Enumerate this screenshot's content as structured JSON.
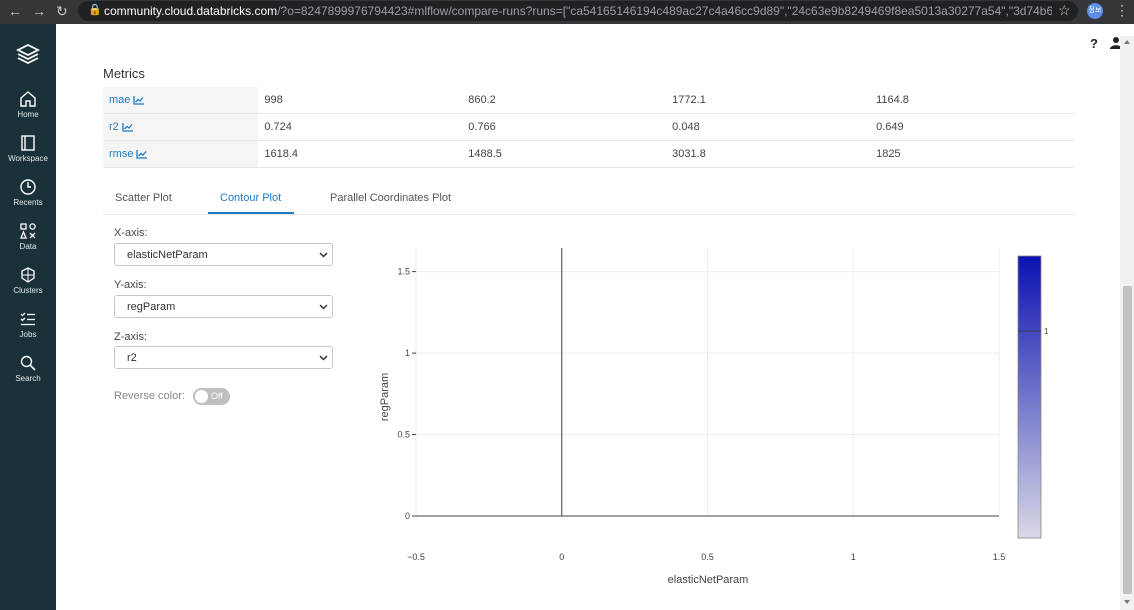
{
  "browser": {
    "url_host": "community.cloud.databricks.com",
    "url_rest": "/?o=8247899976794423#mlflow/compare-runs?runs=[\"ca54165146194c489ac27c4a46cc9d89\",\"24c63e9b8249469f8ea5013a30277a54\",\"3d74b625a8e246c390d58907c0086...",
    "profile_label": "정보"
  },
  "sidebar": {
    "items": [
      {
        "label": "Home",
        "icon": "home-icon"
      },
      {
        "label": "Workspace",
        "icon": "workspace-icon"
      },
      {
        "label": "Recents",
        "icon": "clock-icon"
      },
      {
        "label": "Data",
        "icon": "data-icon"
      },
      {
        "label": "Clusters",
        "icon": "clusters-icon"
      },
      {
        "label": "Jobs",
        "icon": "jobs-icon"
      },
      {
        "label": "Search",
        "icon": "search-icon"
      }
    ]
  },
  "header": {
    "help": "?"
  },
  "metrics": {
    "title": "Metrics",
    "rows": [
      {
        "name": "mae",
        "values": [
          "998",
          "860.2",
          "1772.1",
          "1164.8"
        ]
      },
      {
        "name": "r2",
        "values": [
          "0.724",
          "0.766",
          "0.048",
          "0.649"
        ]
      },
      {
        "name": "rmse",
        "values": [
          "1618.4",
          "1488.5",
          "3031.8",
          "1825"
        ]
      }
    ]
  },
  "tabs": [
    {
      "label": "Scatter Plot",
      "active": false
    },
    {
      "label": "Contour Plot",
      "active": true
    },
    {
      "label": "Parallel Coordinates Plot",
      "active": false
    }
  ],
  "controls": {
    "x_axis_label": "X-axis:",
    "x_axis_value": "elasticNetParam",
    "y_axis_label": "Y-axis:",
    "y_axis_value": "regParam",
    "z_axis_label": "Z-axis:",
    "z_axis_value": "r2",
    "reverse_color_label": "Reverse color:",
    "toggle_text": "Off"
  },
  "chart_data": {
    "type": "contour",
    "xlabel": "elasticNetParam",
    "ylabel": "regParam",
    "xlim": [
      -0.5,
      1.5
    ],
    "ylim": [
      0,
      1.5
    ],
    "x_ticks": [
      "−0.5",
      "0",
      "0.5",
      "1",
      "1.5"
    ],
    "y_ticks": [
      "0",
      "0.5",
      "1",
      "1.5"
    ],
    "colorbar_ticks": [
      "1"
    ],
    "colorscale": [
      "#d8d8e6",
      "#0b12b0"
    ],
    "grid": true
  }
}
